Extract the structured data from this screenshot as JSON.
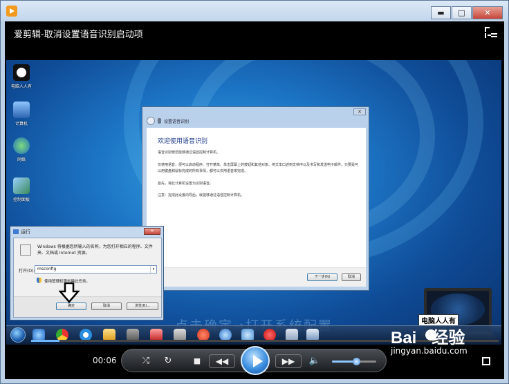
{
  "window": {
    "minimize_glyph": "▬",
    "maximize_glyph": "□",
    "close_glyph": "✕"
  },
  "player": {
    "title": "爱剪辑-取消设置语音识别启动项",
    "current_time": "00:06",
    "progress_fraction": 0.06,
    "volume_fraction": 0.55
  },
  "desktop": {
    "icons": [
      {
        "label": "电脑人人有",
        "icon": "panda-icon"
      },
      {
        "label": "计算机",
        "icon": "computer-icon"
      },
      {
        "label": "网络",
        "icon": "network-icon"
      },
      {
        "label": "控制面板",
        "icon": "control-panel-icon"
      }
    ]
  },
  "speech_dialog": {
    "title": "设置语音识别",
    "heading": "欢迎使用语音识别",
    "paragraphs": [
      "语音识别使您能够通过语音控制计算机。",
      "仅使用语音，便可以启动程序、打开菜单、单击屏幕上的按钮和其他对象、将文本口述到文档中以及书写和发送电子邮件。只要是可以用键盘和鼠标完成的所有事情，都可以仅用语音来完成。",
      "首先，将此计算机设置为识别语音。",
      "注意：完成此设置向导后，就能够通过语音控制计算机。"
    ],
    "next_button": "下一步(N)",
    "cancel_button": "取消"
  },
  "run_dialog": {
    "title": "运行",
    "close_glyph": "✕",
    "description": "Windows 将根据您所输入的名称，为您打开相应的程序、文件夹、文档或 Internet 资源。",
    "open_label": "打开(O):",
    "open_value": "msconfig",
    "admin_note": "使用管理权限创建此任务。",
    "ok_button": "确定",
    "cancel_button": "取消",
    "browse_button": "浏览(B)..."
  },
  "watermark": "点击确定→打开系统配置",
  "logo": {
    "laptop_caption": "电脑人人有"
  },
  "baidu": {
    "brand": "Bai",
    "brand_suffix": "经验",
    "url": "jingyan.baidu.com"
  },
  "colors": {
    "accent": "#3c8fe0",
    "desktop": "#1c74c4"
  }
}
